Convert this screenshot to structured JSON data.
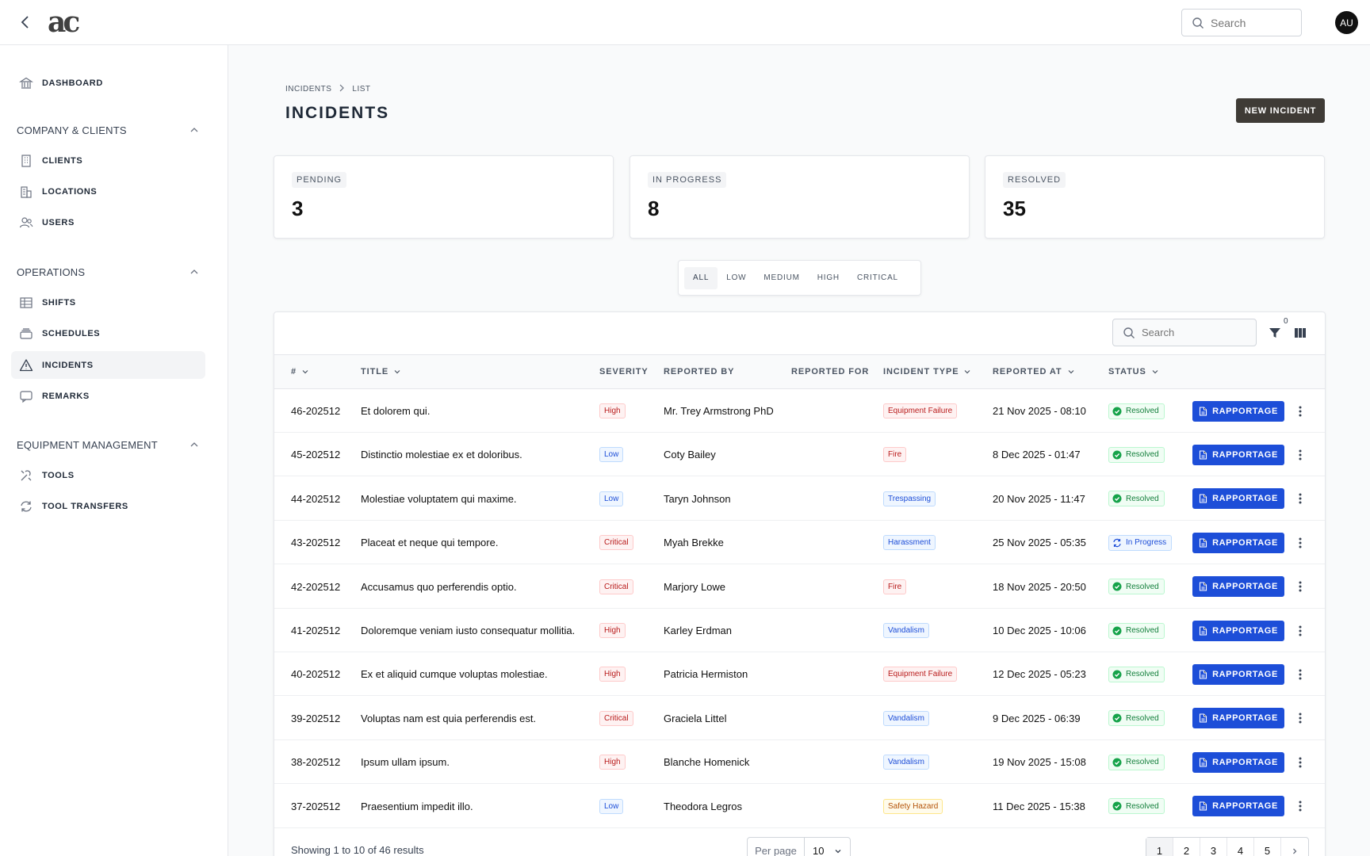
{
  "topbar": {
    "logo": "ac",
    "search_placeholder": "Search",
    "avatar": "AU"
  },
  "sidebar": {
    "dashboard": "DASHBOARD",
    "groups": {
      "company": "COMPANY & CLIENTS",
      "operations": "OPERATIONS",
      "equipment": "EQUIPMENT MANAGEMENT"
    },
    "items": {
      "clients": "CLIENTS",
      "locations": "LOCATIONS",
      "users": "USERS",
      "shifts": "SHIFTS",
      "schedules": "SCHEDULES",
      "incidents": "INCIDENTS",
      "remarks": "REMARKS",
      "tools": "TOOLS",
      "tool_transfers": "TOOL TRANSFERS"
    },
    "active": "incidents"
  },
  "breadcrumb": [
    "INCIDENTS",
    "LIST"
  ],
  "page_title": "INCIDENTS",
  "new_button": "NEW INCIDENT",
  "stats": [
    {
      "label": "PENDING",
      "value": "3"
    },
    {
      "label": "IN PROGRESS",
      "value": "8"
    },
    {
      "label": "RESOLVED",
      "value": "35"
    }
  ],
  "severity_filter": {
    "options": [
      "ALL",
      "LOW",
      "MEDIUM",
      "HIGH",
      "CRITICAL"
    ],
    "selected": "ALL"
  },
  "table": {
    "search_placeholder": "Search",
    "filter_count": "0",
    "columns": {
      "id": "#",
      "title": "TITLE",
      "severity": "SEVERITY",
      "reported_by": "REPORTED BY",
      "reported_for": "REPORTED FOR",
      "incident_type": "INCIDENT TYPE",
      "reported_at": "REPORTED AT",
      "status": "STATUS"
    },
    "action_label": "RAPPORTAGE",
    "rows": [
      {
        "id": "46-202512",
        "title": "Et dolorem qui.",
        "severity": "High",
        "reported_by": "Mr. Trey Armstrong PhD",
        "reported_for": "",
        "type": "Equipment Failure",
        "type_color": "red",
        "reported_at": "21 Nov 2025 - 08:10",
        "status": "Resolved"
      },
      {
        "id": "45-202512",
        "title": "Distinctio molestiae ex et doloribus.",
        "severity": "Low",
        "reported_by": "Coty Bailey",
        "reported_for": "",
        "type": "Fire",
        "type_color": "red",
        "reported_at": "8 Dec 2025 - 01:47",
        "status": "Resolved"
      },
      {
        "id": "44-202512",
        "title": "Molestiae voluptatem qui maxime.",
        "severity": "Low",
        "reported_by": "Taryn Johnson",
        "reported_for": "",
        "type": "Trespassing",
        "type_color": "blue",
        "reported_at": "20 Nov 2025 - 11:47",
        "status": "Resolved"
      },
      {
        "id": "43-202512",
        "title": "Placeat et neque qui tempore.",
        "severity": "Critical",
        "reported_by": "Myah Brekke",
        "reported_for": "",
        "type": "Harassment",
        "type_color": "blue",
        "reported_at": "25 Nov 2025 - 05:35",
        "status": "In Progress"
      },
      {
        "id": "42-202512",
        "title": "Accusamus quo perferendis optio.",
        "severity": "Critical",
        "reported_by": "Marjory Lowe",
        "reported_for": "",
        "type": "Fire",
        "type_color": "red",
        "reported_at": "18 Nov 2025 - 20:50",
        "status": "Resolved"
      },
      {
        "id": "41-202512",
        "title": "Doloremque veniam iusto consequatur mollitia.",
        "severity": "High",
        "reported_by": "Karley Erdman",
        "reported_for": "",
        "type": "Vandalism",
        "type_color": "blue",
        "reported_at": "10 Dec 2025 - 10:06",
        "status": "Resolved"
      },
      {
        "id": "40-202512",
        "title": "Ex et aliquid cumque voluptas molestiae.",
        "severity": "High",
        "reported_by": "Patricia Hermiston",
        "reported_for": "",
        "type": "Equipment Failure",
        "type_color": "red",
        "reported_at": "12 Dec 2025 - 05:23",
        "status": "Resolved"
      },
      {
        "id": "39-202512",
        "title": "Voluptas nam est quia perferendis est.",
        "severity": "Critical",
        "reported_by": "Graciela Littel",
        "reported_for": "",
        "type": "Vandalism",
        "type_color": "blue",
        "reported_at": "9 Dec 2025 - 06:39",
        "status": "Resolved"
      },
      {
        "id": "38-202512",
        "title": "Ipsum ullam ipsum.",
        "severity": "High",
        "reported_by": "Blanche Homenick",
        "reported_for": "",
        "type": "Vandalism",
        "type_color": "blue",
        "reported_at": "19 Nov 2025 - 15:08",
        "status": "Resolved"
      },
      {
        "id": "37-202512",
        "title": "Praesentium impedit illo.",
        "severity": "Low",
        "reported_by": "Theodora Legros",
        "reported_for": "",
        "type": "Safety Hazard",
        "type_color": "orange",
        "reported_at": "11 Dec 2025 - 15:38",
        "status": "Resolved"
      }
    ]
  },
  "footer": {
    "summary": "Showing 1 to 10 of 46 results",
    "per_page_label": "Per page",
    "per_page_value": "10",
    "pages": [
      "1",
      "2",
      "3",
      "4",
      "5"
    ],
    "current_page": "1"
  },
  "colors": {
    "primary": "#1d4ed8",
    "new_button": "#3f3b36",
    "danger": "#b91c1c",
    "success": "#15803d",
    "warning": "#b45309"
  }
}
